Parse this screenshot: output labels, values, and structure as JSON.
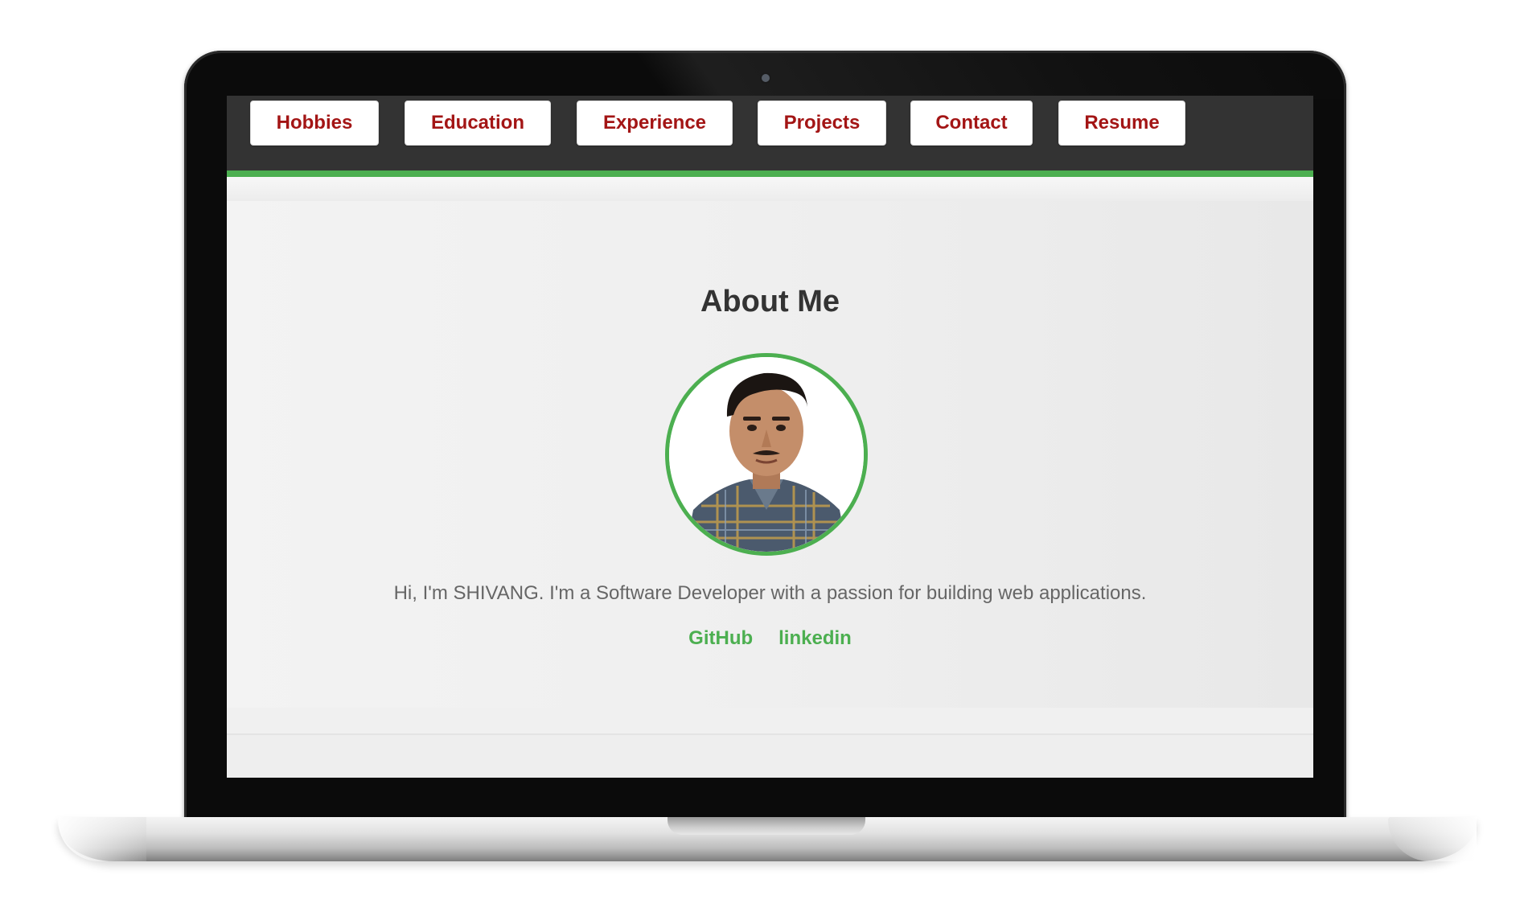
{
  "nav": {
    "items": [
      {
        "label": "Hobbies"
      },
      {
        "label": "Education"
      },
      {
        "label": "Experience"
      },
      {
        "label": "Projects"
      },
      {
        "label": "Contact"
      },
      {
        "label": "Resume"
      }
    ]
  },
  "about": {
    "title": "About Me",
    "text": "Hi, I'm SHIVANG. I'm a Software Developer with a passion for building web applications.",
    "links": [
      {
        "label": "GitHub"
      },
      {
        "label": "linkedin"
      }
    ]
  },
  "colors": {
    "accent_green": "#4caf50",
    "nav_text_red": "#a31515",
    "navbar_bg": "#333333",
    "page_bg": "#f2f2f2"
  },
  "icons": {
    "avatar": "profile-photo"
  }
}
